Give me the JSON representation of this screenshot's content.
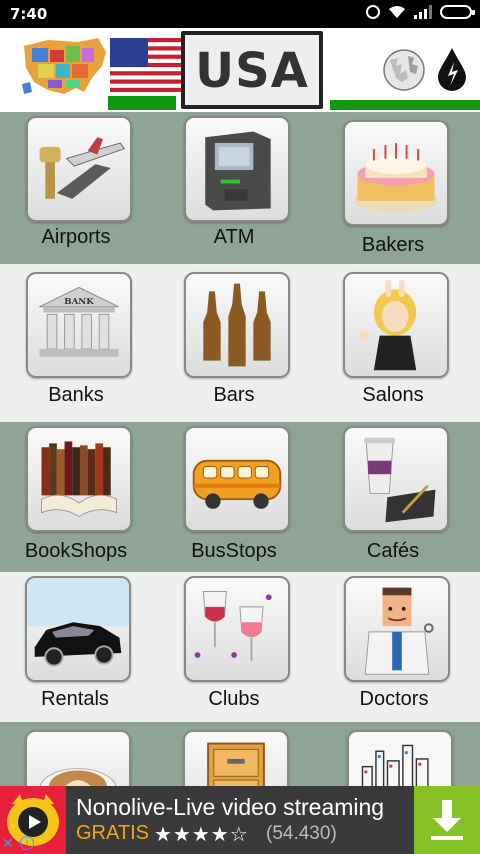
{
  "status_bar": {
    "time": "7:40"
  },
  "header": {
    "title": "USA"
  },
  "categories": [
    {
      "label": "Airports",
      "icon": "airplane-icon"
    },
    {
      "label": "ATM",
      "icon": "atm-icon"
    },
    {
      "label": "Bakers",
      "icon": "cake-icon"
    },
    {
      "label": "Banks",
      "icon": "bank-icon"
    },
    {
      "label": "Bars",
      "icon": "beer-bottles-icon"
    },
    {
      "label": "Salons",
      "icon": "salon-woman-icon"
    },
    {
      "label": "BookShops",
      "icon": "books-icon"
    },
    {
      "label": "BusStops",
      "icon": "bus-icon"
    },
    {
      "label": "Cafés",
      "icon": "coffee-cup-icon"
    },
    {
      "label": "Rentals",
      "icon": "car-icon"
    },
    {
      "label": "Clubs",
      "icon": "wine-glasses-icon"
    },
    {
      "label": "Doctors",
      "icon": "doctor-icon"
    },
    {
      "label": "",
      "icon": "latte-icon"
    },
    {
      "label": "",
      "icon": "file-drawer-icon"
    },
    {
      "label": "",
      "icon": "city-skyline-icon"
    }
  ],
  "ad": {
    "title": "Nonolive-Live video streaming",
    "free_label": "GRATIS",
    "stars": "★★★★☆",
    "rating_count": "(54.430)",
    "close_glyph": "✕",
    "info_glyph": "i"
  },
  "colors": {
    "row_green": "#8fa396",
    "row_light": "#eef0ef",
    "ad_green": "#86c126",
    "ad_orange": "#f2a421"
  }
}
